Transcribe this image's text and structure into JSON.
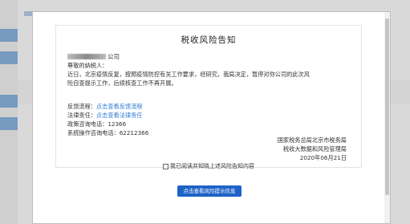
{
  "notice": {
    "title": "税收风险告知",
    "company_suffix": "公司",
    "salutation": "尊敬的纳税人：",
    "paragraph_line1": "近日，北京疫情反复，按照疫情防控有关工作要求，经研究，我局决定，暂停对你公司的此次风",
    "paragraph_line2": "险自查提示工作，后续核查工作不再开展。",
    "feedback_label": "反馈流程：",
    "feedback_link": "点击查看反馈流程",
    "legal_label": "法律责任：",
    "legal_link": "点击查看法律责任",
    "hotline_label": "政策咨询电话：",
    "hotline_value": "12366",
    "ops_label": "系统操作咨询电话：",
    "ops_value": "62212366",
    "sign_line1": "国家税务总局北京市税务局",
    "sign_line2": "税收大数据和风险管理局",
    "sign_date": "2020年06月21日",
    "agree_text": "我已阅读并知晓上述风险告知内容"
  },
  "buttons": {
    "view_tips": "点击查看风险提示信息"
  },
  "colors": {
    "accent": "#1e63c7",
    "link": "#2f7bd6"
  }
}
